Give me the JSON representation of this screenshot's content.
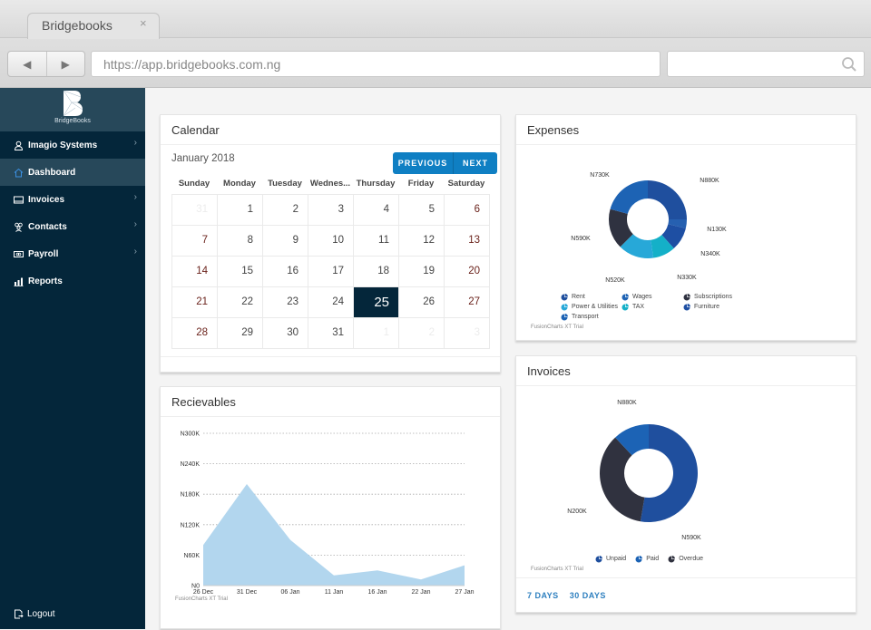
{
  "browser": {
    "tab_title": "Bridgebooks",
    "tab_close": "×",
    "url": "https://app.bridgebooks.com.ng",
    "back_icon": "◀",
    "forward_icon": "▶",
    "search_value": ""
  },
  "sidebar": {
    "brand_name": "BridgeBooks",
    "items": [
      {
        "label": "Imagio Systems",
        "icon": "user-icon",
        "has_chevron": true
      },
      {
        "label": "Dashboard",
        "icon": "home-icon",
        "has_chevron": false,
        "active": true
      },
      {
        "label": "Invoices",
        "icon": "invoice-icon",
        "has_chevron": true
      },
      {
        "label": "Contacts",
        "icon": "contacts-icon",
        "has_chevron": true
      },
      {
        "label": "Payroll",
        "icon": "payroll-icon",
        "has_chevron": true
      },
      {
        "label": "Reports",
        "icon": "reports-icon",
        "has_chevron": false
      }
    ],
    "chevron": "›",
    "logout_label": "Logout"
  },
  "calendar": {
    "title": "Calendar",
    "month_label": "January 2018",
    "previous_label": "PREVIOUS",
    "next_label": "NEXT",
    "weekdays": [
      "Sunday",
      "Monday",
      "Tuesday",
      "Wednes...",
      "Thursday",
      "Friday",
      "Saturday"
    ],
    "weeks": [
      [
        {
          "d": "31",
          "o": true
        },
        {
          "d": "1"
        },
        {
          "d": "2"
        },
        {
          "d": "3"
        },
        {
          "d": "4"
        },
        {
          "d": "5"
        },
        {
          "d": "6"
        }
      ],
      [
        {
          "d": "7"
        },
        {
          "d": "8"
        },
        {
          "d": "9"
        },
        {
          "d": "10"
        },
        {
          "d": "11"
        },
        {
          "d": "12"
        },
        {
          "d": "13"
        }
      ],
      [
        {
          "d": "14"
        },
        {
          "d": "15"
        },
        {
          "d": "16"
        },
        {
          "d": "17"
        },
        {
          "d": "18"
        },
        {
          "d": "19"
        },
        {
          "d": "20"
        }
      ],
      [
        {
          "d": "21"
        },
        {
          "d": "22"
        },
        {
          "d": "23"
        },
        {
          "d": "24"
        },
        {
          "d": "25",
          "today": true
        },
        {
          "d": "26"
        },
        {
          "d": "27"
        }
      ],
      [
        {
          "d": "28"
        },
        {
          "d": "29"
        },
        {
          "d": "30"
        },
        {
          "d": "31"
        },
        {
          "d": "1",
          "o": true
        },
        {
          "d": "2",
          "o": true
        },
        {
          "d": "3",
          "o": true
        }
      ]
    ]
  },
  "receivables": {
    "title": "Recievables",
    "trial_text": "FusionCharts XT Trial"
  },
  "expenses": {
    "title": "Expenses",
    "trial_text": "FusionCharts XT Trial"
  },
  "invoices": {
    "title": "Invoices",
    "trial_text": "FusionCharts XT Trial",
    "footer_links": [
      "7 DAYS",
      "30 DAYS"
    ]
  },
  "chart_data": [
    {
      "id": "receivables",
      "type": "area",
      "title": "Recievables",
      "x": [
        "26 Dec",
        "31 Dec",
        "06 Jan",
        "11 Jan",
        "16 Jan",
        "22 Jan",
        "27 Jan"
      ],
      "values": [
        80000,
        200000,
        90000,
        20000,
        30000,
        12000,
        40000
      ],
      "ylim": [
        0,
        300000
      ],
      "yticks": [
        "N0",
        "N60K",
        "N120K",
        "N180K",
        "N240K",
        "N300K"
      ],
      "ytick_values": [
        0,
        60000,
        120000,
        180000,
        240000,
        300000
      ],
      "grid": true,
      "color": "#b2d6ee"
    },
    {
      "id": "expenses",
      "type": "pie",
      "donut": true,
      "title": "Expenses",
      "slices": [
        {
          "name": "Rent",
          "value": 880,
          "label": "N880K",
          "color": "#1f4f9e"
        },
        {
          "name": "Wages",
          "value": 130,
          "label": "N130K",
          "color": "#2660b0"
        },
        {
          "name": "Subscriptions",
          "value": 340,
          "label": "N340K",
          "color": "#1e4fa3"
        },
        {
          "name": "Power & Utilities",
          "value": 330,
          "label": "N330K",
          "color": "#14b0c8"
        },
        {
          "name": "TAX",
          "value": 520,
          "label": "N520K",
          "color": "#27a8d8"
        },
        {
          "name": "Furniture",
          "value": 590,
          "label": "N590K",
          "color": "#2f3240"
        },
        {
          "name": "Transport",
          "value": 730,
          "label": "N730K",
          "color": "#1d63b4"
        }
      ],
      "legend": [
        "Rent",
        "Wages",
        "Subscriptions",
        "Power & Utilities",
        "TAX",
        "Furniture",
        "Transport"
      ],
      "legend_colors": [
        "#1f4f9e",
        "#1d63b4",
        "#2f3240",
        "#27a8d8",
        "#14b0c8",
        "#1e4fa3",
        "#1d63b4"
      ],
      "legend_position": "bottom"
    },
    {
      "id": "invoices",
      "type": "pie",
      "donut": true,
      "title": "Invoices",
      "slices": [
        {
          "name": "Unpaid",
          "value": 880,
          "label": "N880K",
          "color": "#1f4f9e"
        },
        {
          "name": "Overdue",
          "value": 590,
          "label": "N590K",
          "color": "#30323f"
        },
        {
          "name": "Paid",
          "value": 200,
          "label": "N200K",
          "color": "#1c63b5"
        }
      ],
      "legend": [
        "Unpaid",
        "Paid",
        "Overdue"
      ],
      "legend_colors": [
        "#1f4f9e",
        "#1c63b5",
        "#30323f"
      ],
      "legend_position": "bottom"
    }
  ]
}
